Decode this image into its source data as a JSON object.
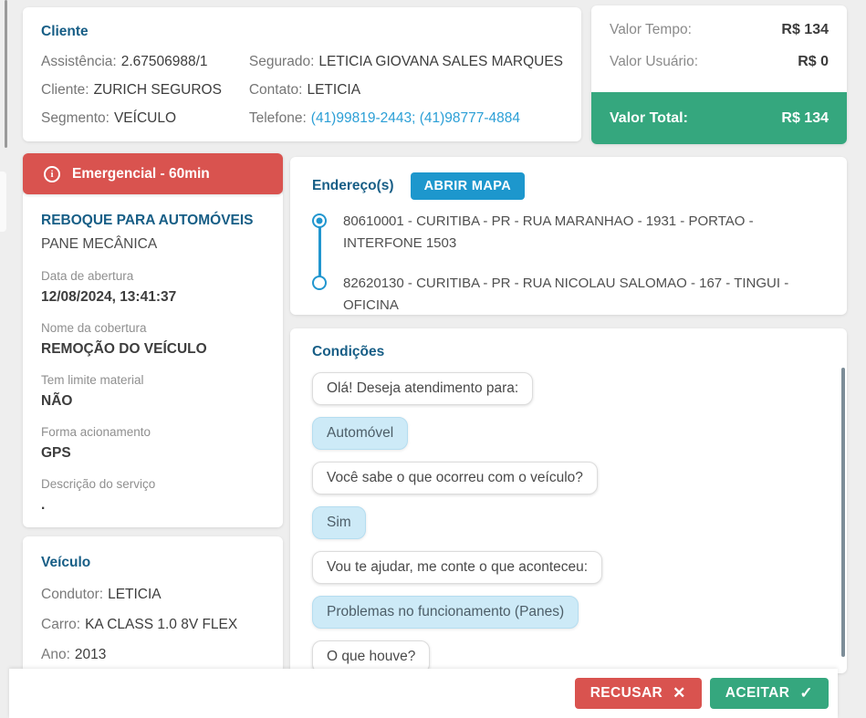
{
  "client_card": {
    "title": "Cliente",
    "left": [
      {
        "label": "Assistência:",
        "value": "2.67506988/1"
      },
      {
        "label": "Cliente:",
        "value": "ZURICH SEGUROS"
      },
      {
        "label": "Segmento:",
        "value": "VEÍCULO"
      }
    ],
    "right": [
      {
        "label": "Segurado:",
        "value": "LETICIA GIOVANA SALES MARQUES"
      },
      {
        "label": "Contato:",
        "value": "LETICIA"
      },
      {
        "label": "Telefone:",
        "value": "(41)99819-2443; (41)98777-4884"
      }
    ]
  },
  "pricing_card": {
    "rows": [
      {
        "label": "Valor Tempo:",
        "value": "R$ 134"
      },
      {
        "label": "Valor Usuário:",
        "value": "R$ 0"
      }
    ],
    "total": {
      "label": "Valor Total:",
      "value": "R$ 134"
    }
  },
  "service_card": {
    "banner": "Emergencial - 60min",
    "title": "REBOQUE PARA AUTOMÓVEIS",
    "subtitle": "PANE MECÂNICA",
    "fields": [
      {
        "label": "Data de abertura",
        "value": "12/08/2024, 13:41:37"
      },
      {
        "label": "Nome da cobertura",
        "value": "REMOÇÃO DO VEÍCULO"
      },
      {
        "label": "Tem limite material",
        "value": "NÃO"
      },
      {
        "label": "Forma acionamento",
        "value": "GPS"
      },
      {
        "label": "Descrição do serviço",
        "value": "."
      }
    ]
  },
  "vehicle_card": {
    "title": "Veículo",
    "fields": [
      {
        "label": "Condutor:",
        "value": "LETICIA"
      },
      {
        "label": "Carro:",
        "value": "KA CLASS 1.0 8V FLEX"
      },
      {
        "label": "Ano:",
        "value": "2013"
      }
    ]
  },
  "addresses_card": {
    "title": "Endereço(s)",
    "map_button": "ABRIR MAPA",
    "items": [
      {
        "text": "80610001 - CURITIBA - PR - RUA MARANHAO - 1931 - PORTAO - INTERFONE 1503"
      },
      {
        "text": "82620130 - CURITIBA - PR - RUA NICOLAU SALOMAO - 167 - TINGUI - OFICINA"
      }
    ]
  },
  "conditions_card": {
    "title": "Condições",
    "messages": [
      {
        "from": "bot",
        "text": "Olá! Deseja atendimento para:"
      },
      {
        "from": "user",
        "text": "Automóvel"
      },
      {
        "from": "bot",
        "text": "Você sabe o que ocorreu com o veículo?"
      },
      {
        "from": "user",
        "text": "Sim"
      },
      {
        "from": "bot",
        "text": "Vou te ajudar, me conte o que aconteceu:"
      },
      {
        "from": "user",
        "text": "Problemas no funcionamento (Panes)"
      },
      {
        "from": "bot",
        "text": "O que houve?"
      }
    ]
  },
  "footer": {
    "reject_label": "RECUSAR",
    "reject_icon": "✕",
    "accept_label": "ACEITAR",
    "accept_icon": "✓"
  },
  "icons": {
    "info": "i"
  },
  "colors": {
    "accent_blue": "#175e86",
    "link_blue": "#2b9fd6",
    "button_blue": "#1d97cd",
    "timeline_blue": "#2196cf",
    "danger_red": "#d9534f",
    "success_green": "#35a77e",
    "page_background": "#eeeeee"
  }
}
